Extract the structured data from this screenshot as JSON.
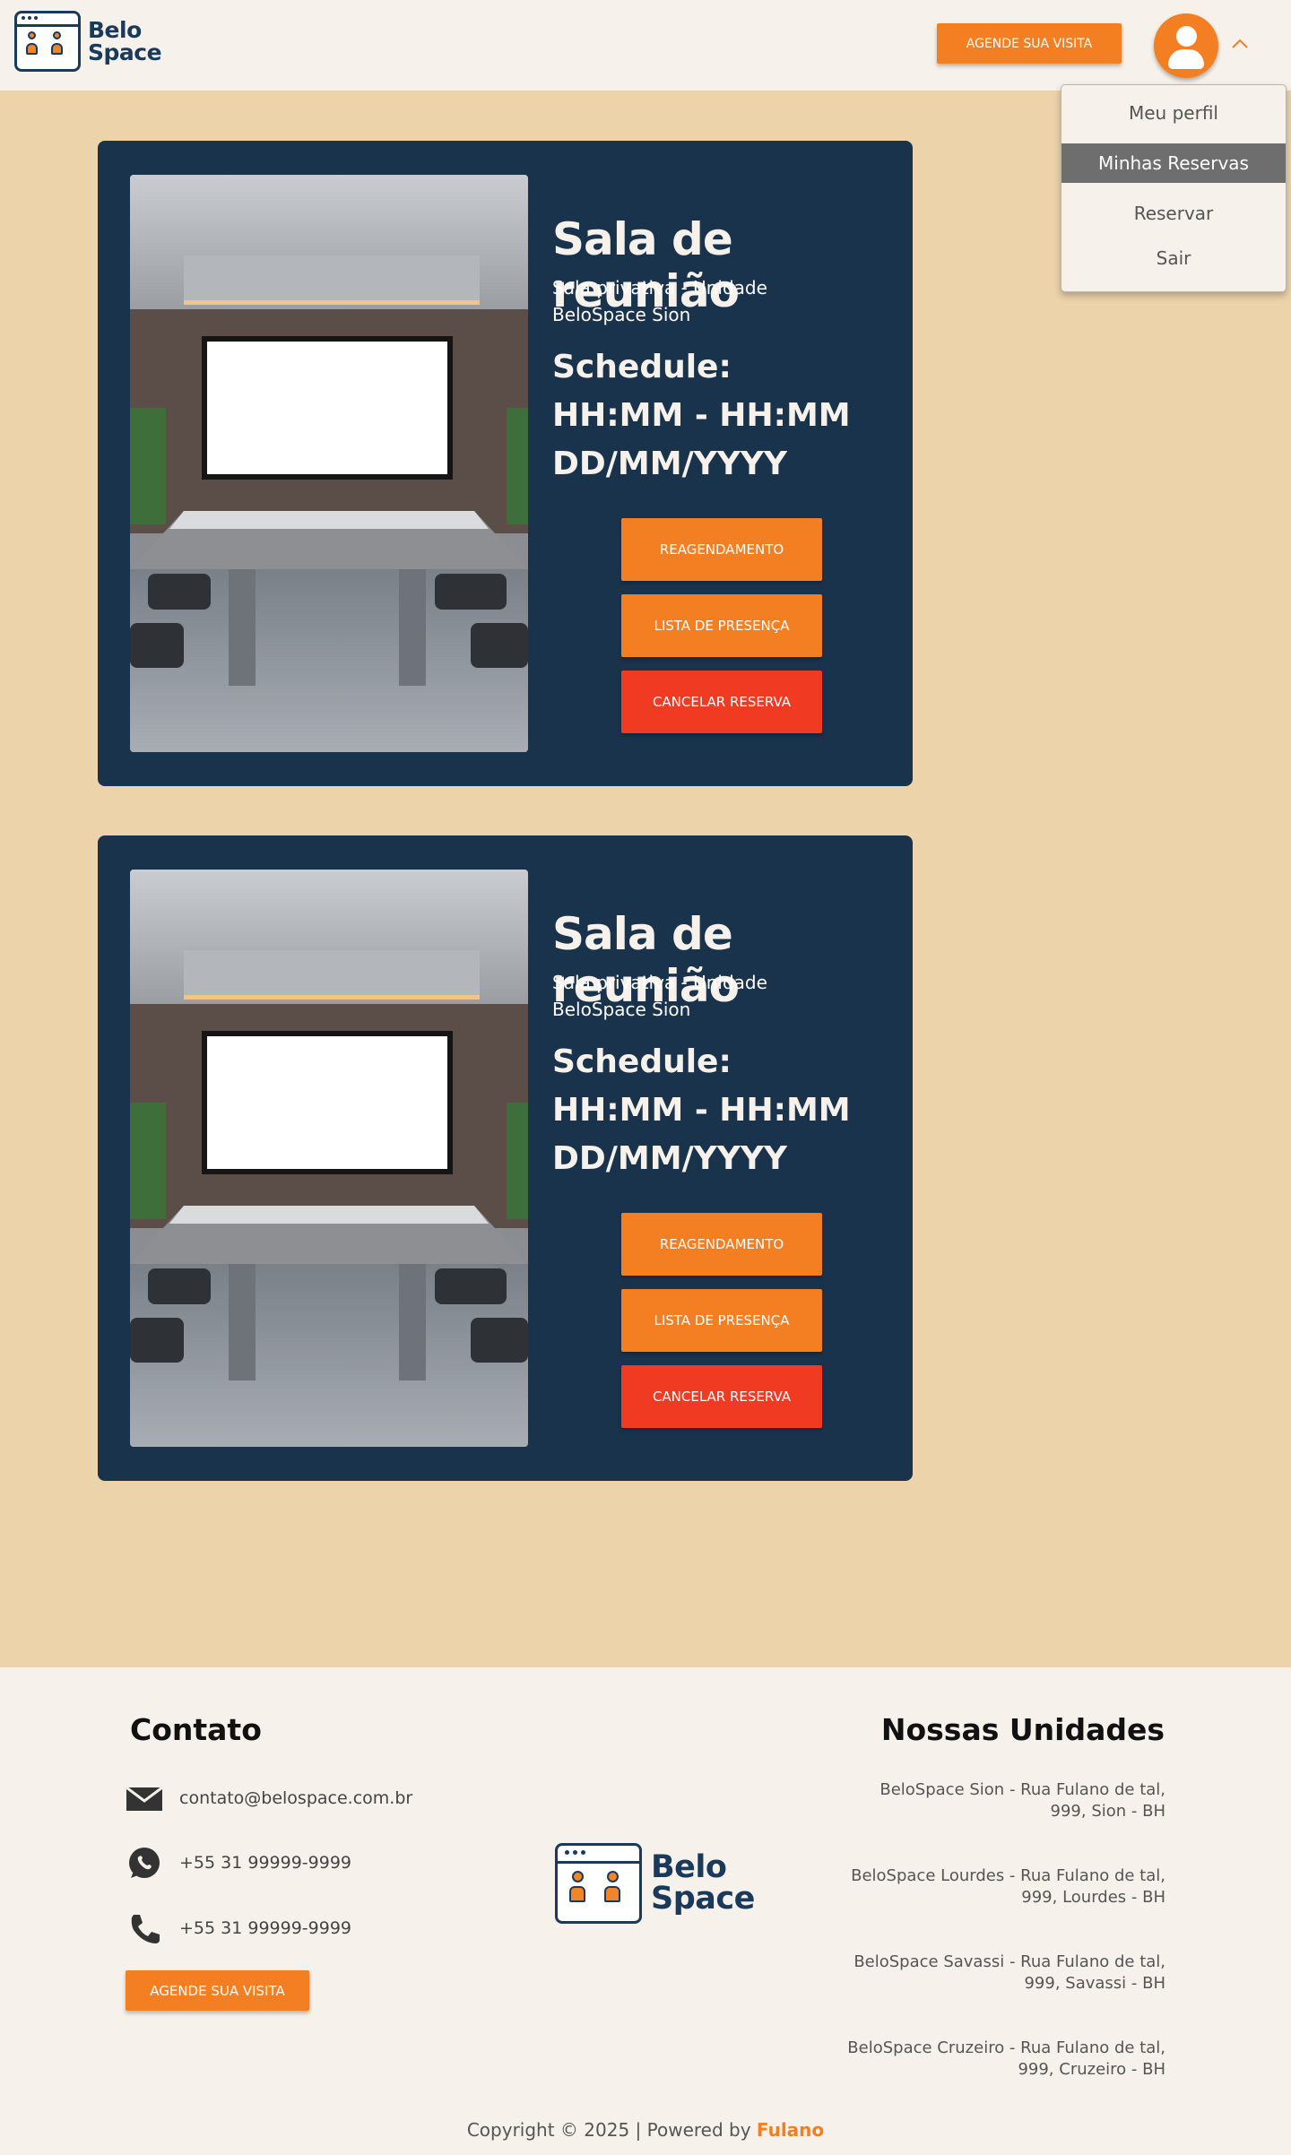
{
  "header": {
    "logo_line1": "Belo",
    "logo_line2": "Space",
    "cta_label": "AGENDE SUA VISITA"
  },
  "user_menu": {
    "items": [
      {
        "label": "Meu perfil",
        "active": false
      },
      {
        "label": "Minhas Reservas",
        "active": true
      },
      {
        "label": "Reservar",
        "active": false
      },
      {
        "label": "Sair",
        "active": false
      }
    ]
  },
  "reservations": [
    {
      "title": "Sala de reunião",
      "subtitle": "Sala privativa - Unidade BeloSpace Sion",
      "schedule_label": "Schedule:",
      "time": "HH:MM - HH:MM",
      "date": "DD/MM/YYYY",
      "reschedule_label": "REAGENDAMENTO",
      "attendance_label": "LISTA DE PRESENÇA",
      "cancel_label": "CANCELAR RESERVA"
    },
    {
      "title": "Sala de reunião",
      "subtitle": "Sala privativa - Unidade BeloSpace Sion",
      "schedule_label": "Schedule:",
      "time": "HH:MM - HH:MM",
      "date": "DD/MM/YYYY",
      "reschedule_label": "REAGENDAMENTO",
      "attendance_label": "LISTA DE PRESENÇA",
      "cancel_label": "CANCELAR RESERVA"
    }
  ],
  "footer": {
    "contact_heading": "Contato",
    "email": "contato@belospace.com.br",
    "whatsapp": "+55 31 99999-9999",
    "phone": "+55 31 99999-9999",
    "cta_label": "AGENDE SUA VISITA",
    "logo_line1": "Belo",
    "logo_line2": "Space",
    "units_heading": "Nossas Unidades",
    "units": [
      {
        "line1": "BeloSpace Sion - Rua Fulano de tal,",
        "line2": "999, Sion - BH"
      },
      {
        "line1": "BeloSpace Lourdes - Rua Fulano de tal,",
        "line2": "999, Lourdes - BH"
      },
      {
        "line1": "BeloSpace Savassi - Rua Fulano de tal,",
        "line2": "999, Savassi - BH"
      },
      {
        "line1": "BeloSpace Cruzeiro - Rua Fulano de tal,",
        "line2": "999, Cruzeiro - BH"
      }
    ],
    "copyright": "Copyright © 2025 | Powered by",
    "powered_by": "Fulano"
  },
  "colors": {
    "accent": "#f47f22",
    "danger": "#f03b22",
    "navy": "#1a334d",
    "main_bg": "#ecd3aa",
    "page_bg": "#f6f1ea"
  }
}
